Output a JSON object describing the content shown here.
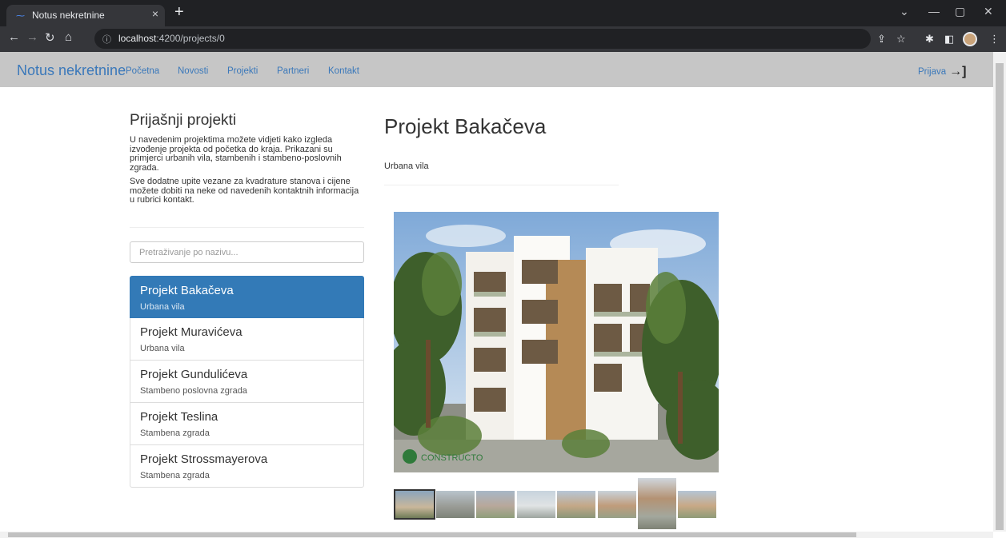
{
  "browser": {
    "tab_title": "Notus nekretnine",
    "tab_close": "×",
    "new_tab": "+",
    "url_host": "localhost",
    "url_rest": ":4200/projects/0",
    "icons": [
      "back-arrow-icon",
      "forward-arrow-icon",
      "reload-icon",
      "home-icon",
      "info-icon",
      "share-icon",
      "star-icon",
      "extensions-icon",
      "sidebar-icon",
      "profile-avatar",
      "menu-icon"
    ]
  },
  "navbar": {
    "brand": "Notus nekretnine",
    "links": [
      "Početna",
      "Novosti",
      "Projekti",
      "Partneri",
      "Kontakt"
    ],
    "login": "Prijava"
  },
  "sidebar": {
    "heading": "Prijašnji projekti",
    "paragraph1": "U navedenim projektima možete vidjeti kako izgleda izvođenje projekta od početka do kraja. Prikazani su primjerci urbanih vila, stambenih i stambeno-poslovnih zgrada.",
    "paragraph2": "Sve dodatne upite vezane za kvadrature stanova i cijene možete dobiti na neke od navedenih kontaktnih informacija u rubrici kontakt.",
    "search_placeholder": "Pretraživanje po nazivu...",
    "projects": [
      {
        "title": "Projekt Bakačeva",
        "subtitle": "Urbana vila",
        "active": true
      },
      {
        "title": "Projekt Muravićeva",
        "subtitle": "Urbana vila",
        "active": false
      },
      {
        "title": "Projekt Gundulićeva",
        "subtitle": "Stambeno poslovna zgrada",
        "active": false
      },
      {
        "title": "Projekt Teslina",
        "subtitle": "Stambena zgrada",
        "active": false
      },
      {
        "title": "Projekt Strossmayerova",
        "subtitle": "Stambena zgrada",
        "active": false
      }
    ]
  },
  "detail": {
    "title": "Projekt Bakačeva",
    "subtitle": "Urbana vila",
    "image_watermark": "CONSTRUCTO",
    "thumbnail_count": 8,
    "selected_thumbnail": 1
  },
  "colors": {
    "accent": "#337ab7",
    "navbar_bg": "#c6c6c6",
    "link": "#3a78ba"
  }
}
